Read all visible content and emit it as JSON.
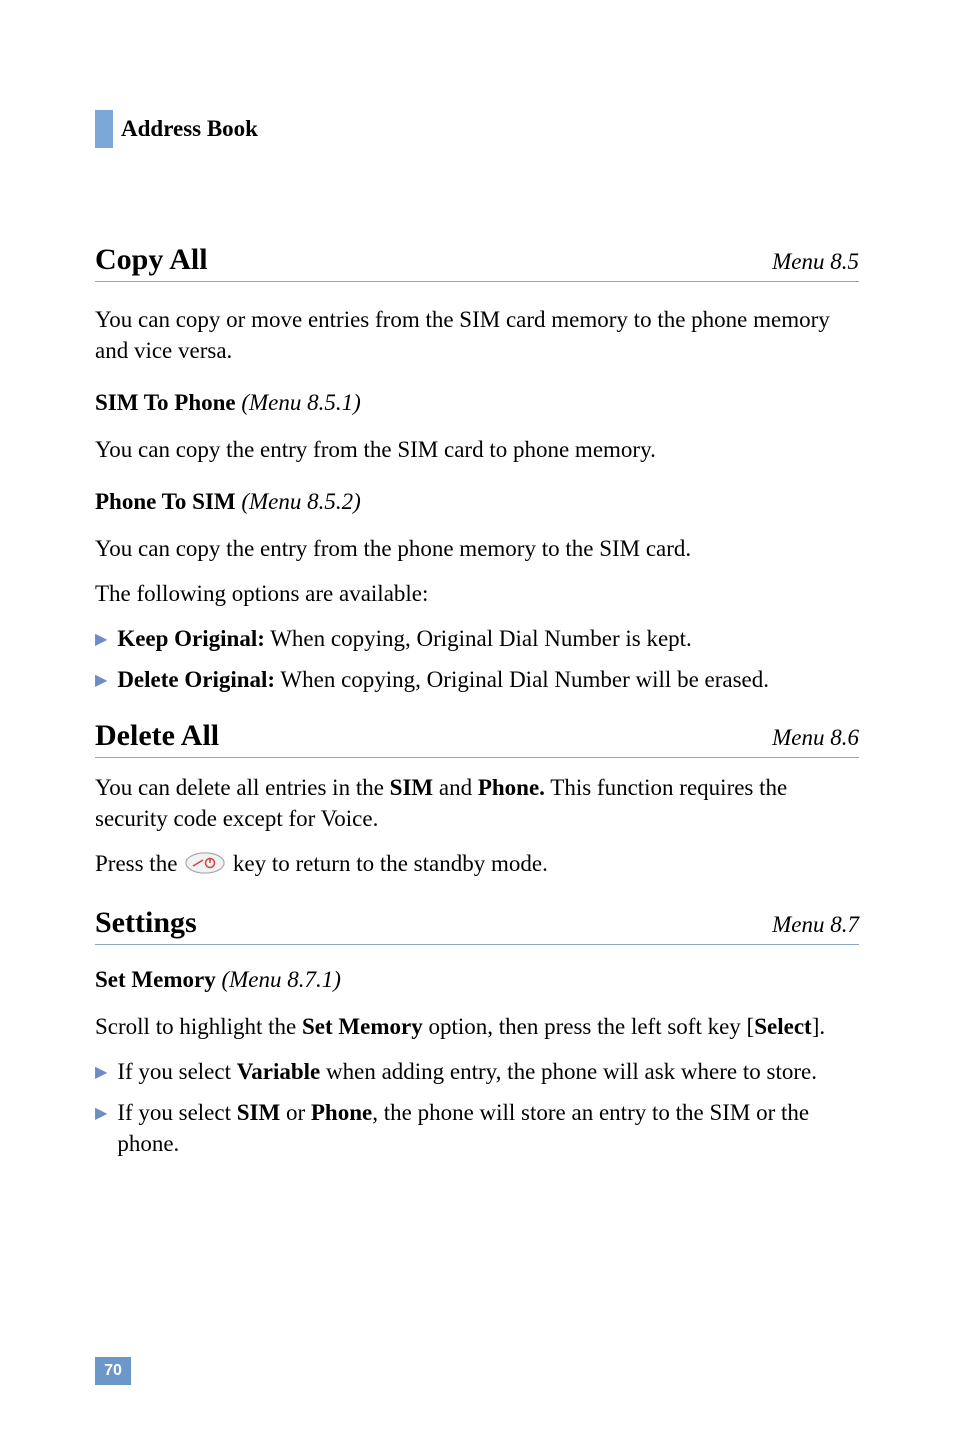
{
  "header": {
    "title": "Address Book"
  },
  "sections": {
    "copyAll": {
      "title": "Copy All",
      "menuLabel": "Menu 8.5",
      "intro": "You can copy or move entries from the SIM card memory to the phone memory and vice versa.",
      "simToPhone": {
        "title": "SIM To Phone",
        "menuLabel": "(Menu 8.5.1)",
        "text": "You can copy the entry from the SIM card to phone memory."
      },
      "phoneToSim": {
        "title": "Phone To SIM",
        "menuLabel": "(Menu 8.5.2)",
        "text1": "You can copy the entry from the phone memory to the SIM card.",
        "text2": "The following options are available:",
        "bullets": [
          {
            "bold": "Keep Original:",
            "rest": " When copying, Original Dial Number is kept."
          },
          {
            "bold": "Delete Original:",
            "rest": " When copying, Original Dial Number will be erased."
          }
        ]
      }
    },
    "deleteAll": {
      "title": "Delete All",
      "menuLabel": "Menu 8.6",
      "text1_pre": "You can delete all entries in the ",
      "text1_sim": "SIM",
      "text1_and": " and ",
      "text1_phone": "Phone.",
      "text1_post": " This function requires the security code except for Voice.",
      "text2_pre": "Press the ",
      "text2_post": " key to return to the standby mode."
    },
    "settings": {
      "title": "Settings",
      "menuLabel": "Menu 8.7",
      "setMemory": {
        "title": "Set Memory",
        "menuLabel": "(Menu 8.7.1)",
        "text_pre": "Scroll to highlight the ",
        "text_bold": "Set Memory",
        "text_mid": " option, then press the left soft key [",
        "text_select": "Select",
        "text_post": "].",
        "bullets": [
          {
            "pre": "If you select ",
            "bold1": "Variable",
            "post": " when adding entry, the phone will ask where to store."
          },
          {
            "pre": "If you select ",
            "bold1": "SIM",
            "or": " or ",
            "bold2": "Phone",
            "post": ", the phone will store an entry to the SIM or the phone."
          }
        ]
      }
    }
  },
  "pageNumber": "70"
}
